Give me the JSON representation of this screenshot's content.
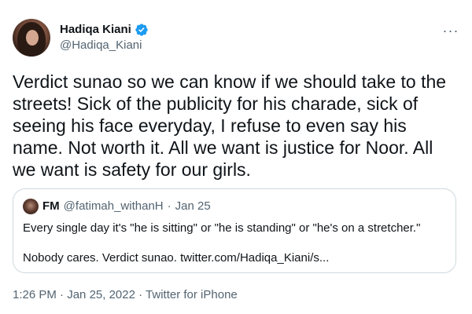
{
  "author": {
    "name": "Hadiqa Kiani",
    "handle": "@Hadiqa_Kiani",
    "verified": true
  },
  "tweet_text": "Verdict sunao so we can know if we should take to the streets! Sick of the publicity for his charade, sick of seeing his face everyday, I refuse to even say his name. Not worth it. All we want is justice for Noor. All we want is safety for our girls.",
  "more_icon": "···",
  "quoted": {
    "name": "FM",
    "handle": "@fatimah_withanH",
    "separator": "·",
    "date": "Jan 25",
    "line1": "Every single day it's \"he is sitting\" or \"he is standing\" or \"he's on a stretcher.\"",
    "line2": "Nobody cares. Verdict sunao. twitter.com/Hadiqa_Kiani/s..."
  },
  "meta": {
    "time": "1:26 PM",
    "dot": "·",
    "date": "Jan 25, 2022",
    "source": "Twitter for iPhone"
  },
  "colors": {
    "text": "#0f1419",
    "secondary": "#536471",
    "verified": "#1d9bf0",
    "border": "#cfd9de"
  }
}
